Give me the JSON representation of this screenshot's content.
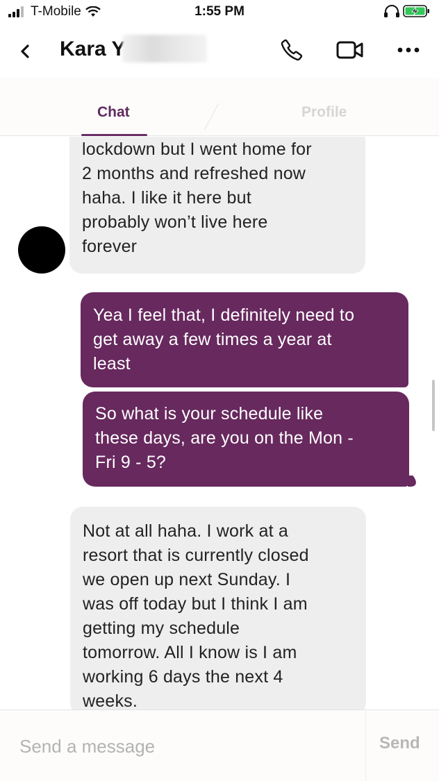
{
  "status_bar": {
    "carrier": "T-Mobile",
    "time": "1:55 PM",
    "battery_color": "#34c759"
  },
  "header": {
    "contact_name": "Kara Y",
    "icons": [
      "back-chevron",
      "phone",
      "video-camera",
      "more-dots"
    ]
  },
  "tabs": [
    {
      "label": "Chat",
      "active": true
    },
    {
      "label": "Profile",
      "active": false
    }
  ],
  "messages": [
    {
      "direction": "incoming",
      "lines": [
        "lockdown but I went home for",
        "2 months and refreshed now",
        "haha. I like it here but",
        "probably won’t live here",
        "forever"
      ]
    },
    {
      "direction": "outgoing",
      "lines": [
        "Yea I feel that, I definitely need to",
        "get away a few times a year at",
        "least"
      ]
    },
    {
      "direction": "outgoing",
      "lines": [
        "So what is your schedule like",
        "these days, are you on the Mon -",
        "Fri 9 - 5?"
      ]
    },
    {
      "direction": "incoming",
      "lines": [
        "Not at all haha. I work at a",
        "resort that is currently closed",
        "we open up next Sunday. I",
        "was off today but I think I am",
        "getting my schedule",
        "tomorrow. All I know is I am",
        "working 6 days the next 4",
        "weeks."
      ]
    }
  ],
  "composer": {
    "placeholder": "Send a message",
    "value": "",
    "send_label": "Send"
  },
  "colors": {
    "accent": "#67295e",
    "incoming_bubble": "#eeeeee",
    "tab_inactive": "#d5d5d5"
  }
}
